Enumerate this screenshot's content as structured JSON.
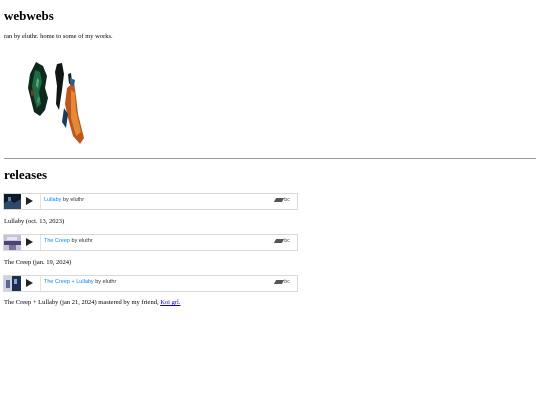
{
  "site": {
    "title": "webwebs",
    "tagline": "ran by eluthr. home to some of my works."
  },
  "releases": {
    "heading": "releases",
    "items": [
      {
        "track": "Lullaby",
        "by": "by",
        "artist": "eluthr",
        "badge": "bc",
        "caption": "Lullaby (oct. 13, 2023)",
        "thumb_colors": [
          "#0d1a2a",
          "#2d4a6a"
        ]
      },
      {
        "track": "The Creep",
        "by": "by",
        "artist": "eluthr",
        "badge": "bc",
        "caption": "The Creep (jan. 19, 2024)",
        "thumb_colors": [
          "#c8c0d8",
          "#4a4470"
        ]
      },
      {
        "track": "The Creep + Lullaby",
        "by": "by",
        "artist": "eluthr",
        "badge": "bc",
        "caption_prefix": "The Creep + Lullaby (jan 21, 2024) mastered by my friend, ",
        "caption_link": "Koi grl.",
        "thumb_colors": [
          "#d0d0e0",
          "#1c2f50"
        ]
      }
    ]
  }
}
